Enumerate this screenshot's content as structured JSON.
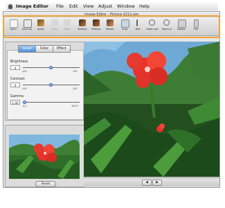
{
  "menubar": {
    "app_name": "Image Editor",
    "items": [
      "File",
      "Edit",
      "View",
      "Adjust",
      "Window",
      "Help"
    ]
  },
  "window": {
    "title": "Image Editor · Picture 0211.jpg"
  },
  "toolbar": {
    "tools": [
      {
        "label": "Open",
        "icon": "open-icon",
        "enabled": true
      },
      {
        "label": "Save as",
        "icon": "save-icon",
        "enabled": true
      },
      {
        "label": "Apply",
        "icon": "apply-icon",
        "enabled": true
      },
      {
        "label": "Undo",
        "icon": "undo-icon",
        "enabled": false
      },
      {
        "label": "Redo",
        "icon": "redo-icon",
        "enabled": false
      },
      {
        "label": "Redeye",
        "icon": "redeye-icon",
        "enabled": true
      },
      {
        "label": "Redeye",
        "icon": "redeye-icon",
        "enabled": true
      },
      {
        "label": "Mosaic",
        "icon": "mosaic-icon",
        "enabled": true
      },
      {
        "label": "Crop",
        "icon": "crop-icon",
        "enabled": true
      },
      {
        "label": "Text",
        "icon": "text-icon",
        "enabled": true
      },
      {
        "label": "Zoom out",
        "icon": "zoom-out-icon",
        "enabled": true
      },
      {
        "label": "Zoom in",
        "icon": "zoom-in-icon",
        "enabled": true
      },
      {
        "label": "Rotate",
        "icon": "rotate-icon",
        "enabled": true
      },
      {
        "label": "Flip",
        "icon": "flip-icon",
        "enabled": true
      }
    ]
  },
  "adjust_panel": {
    "tabs": [
      "Level",
      "Color",
      "Effect"
    ],
    "active_tab": "Level",
    "brightness": {
      "label": "Brightness",
      "value": "0",
      "min": "-100",
      "max": "100",
      "level": 0.5
    },
    "contrast": {
      "label": "Contrast",
      "value": "0",
      "min": "-100",
      "max": "100",
      "level": 0.5
    },
    "gamma": {
      "label": "Gamma",
      "value": "1.00",
      "min": "0.0",
      "max": "100.0",
      "level": 0.01
    }
  },
  "preview_panel": {
    "reset_label": "Reset"
  },
  "bottom_nav": {
    "prev_label": "◀",
    "next_label": "▶"
  },
  "colors": {
    "highlight": "#f2a33a",
    "active_tab": "#4f8ed9",
    "flower": "#e8322b"
  }
}
